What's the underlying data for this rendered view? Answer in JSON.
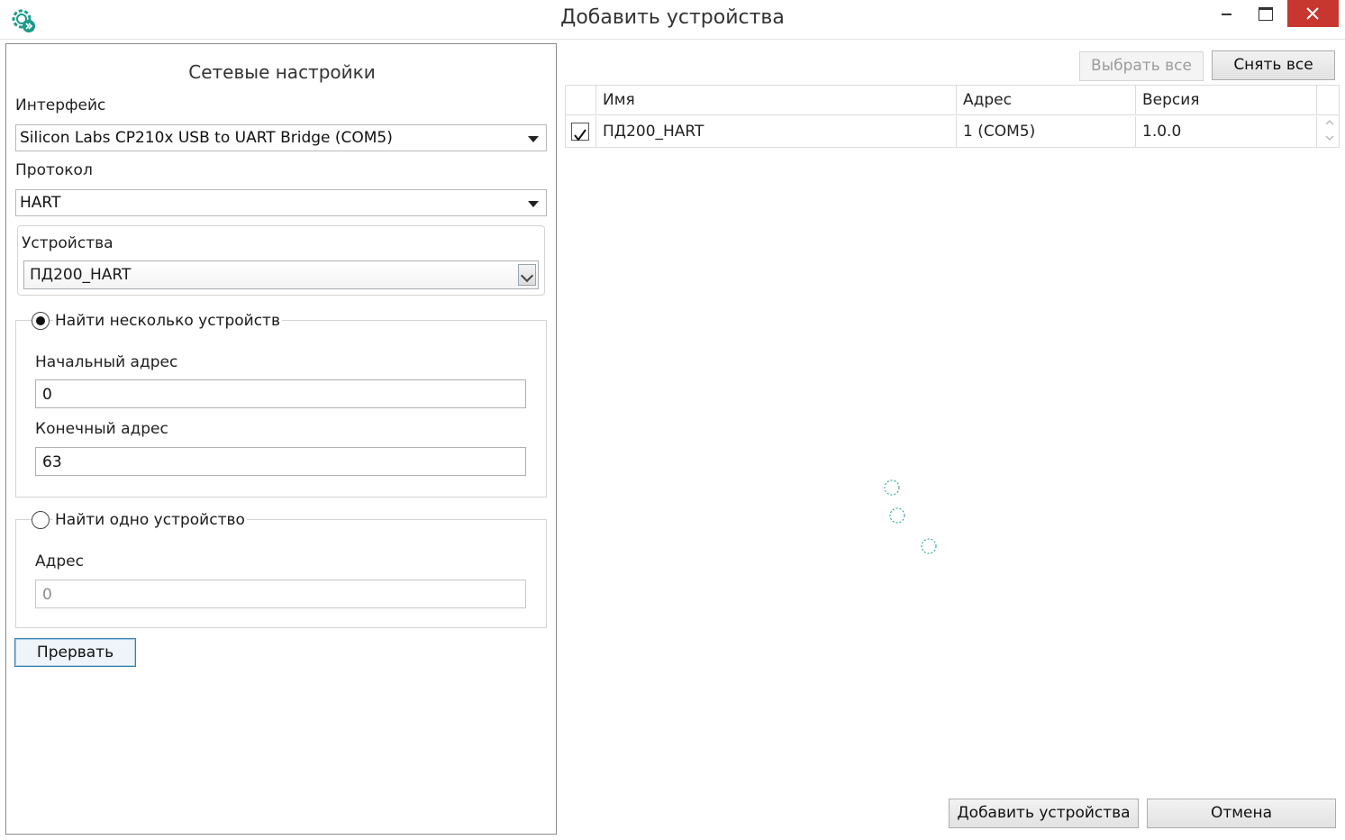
{
  "window": {
    "title": "Добавить устройства",
    "accent_color": "#1a9a8a",
    "close_color": "#c7372f"
  },
  "network_settings": {
    "title": "Сетевые настройки",
    "interface_label": "Интерфейс",
    "interface_value": "Silicon Labs CP210x USB to UART Bridge (COM5)",
    "protocol_label": "Протокол",
    "protocol_value": "HART",
    "devices_label": "Устройства",
    "devices_value": "ПД200_HART"
  },
  "search_multiple": {
    "label": "Найти несколько устройств",
    "selected": true,
    "start_address_label": "Начальный адрес",
    "start_address_value": "0",
    "end_address_label": "Конечный адрес",
    "end_address_value": "63"
  },
  "search_single": {
    "label": "Найти одно устройство",
    "selected": false,
    "address_label": "Адрес",
    "address_value": "0"
  },
  "stop_button": "Прервать",
  "toolbar": {
    "select_all": "Выбрать все",
    "deselect_all": "Снять все"
  },
  "device_table": {
    "columns": [
      "Имя",
      "Адрес",
      "Версия"
    ],
    "rows": [
      {
        "checked": true,
        "name": "ПД200_HART",
        "address": "1 (COM5)",
        "version": "1.0.0"
      }
    ]
  },
  "footer": {
    "add_devices": "Добавить устройства",
    "cancel": "Отмена"
  },
  "icons": {
    "app": "gear-arrow-icon",
    "minimize": "minimize-icon",
    "maximize": "maximize-icon",
    "close": "close-icon",
    "loading": "loading-spinner-icon"
  }
}
